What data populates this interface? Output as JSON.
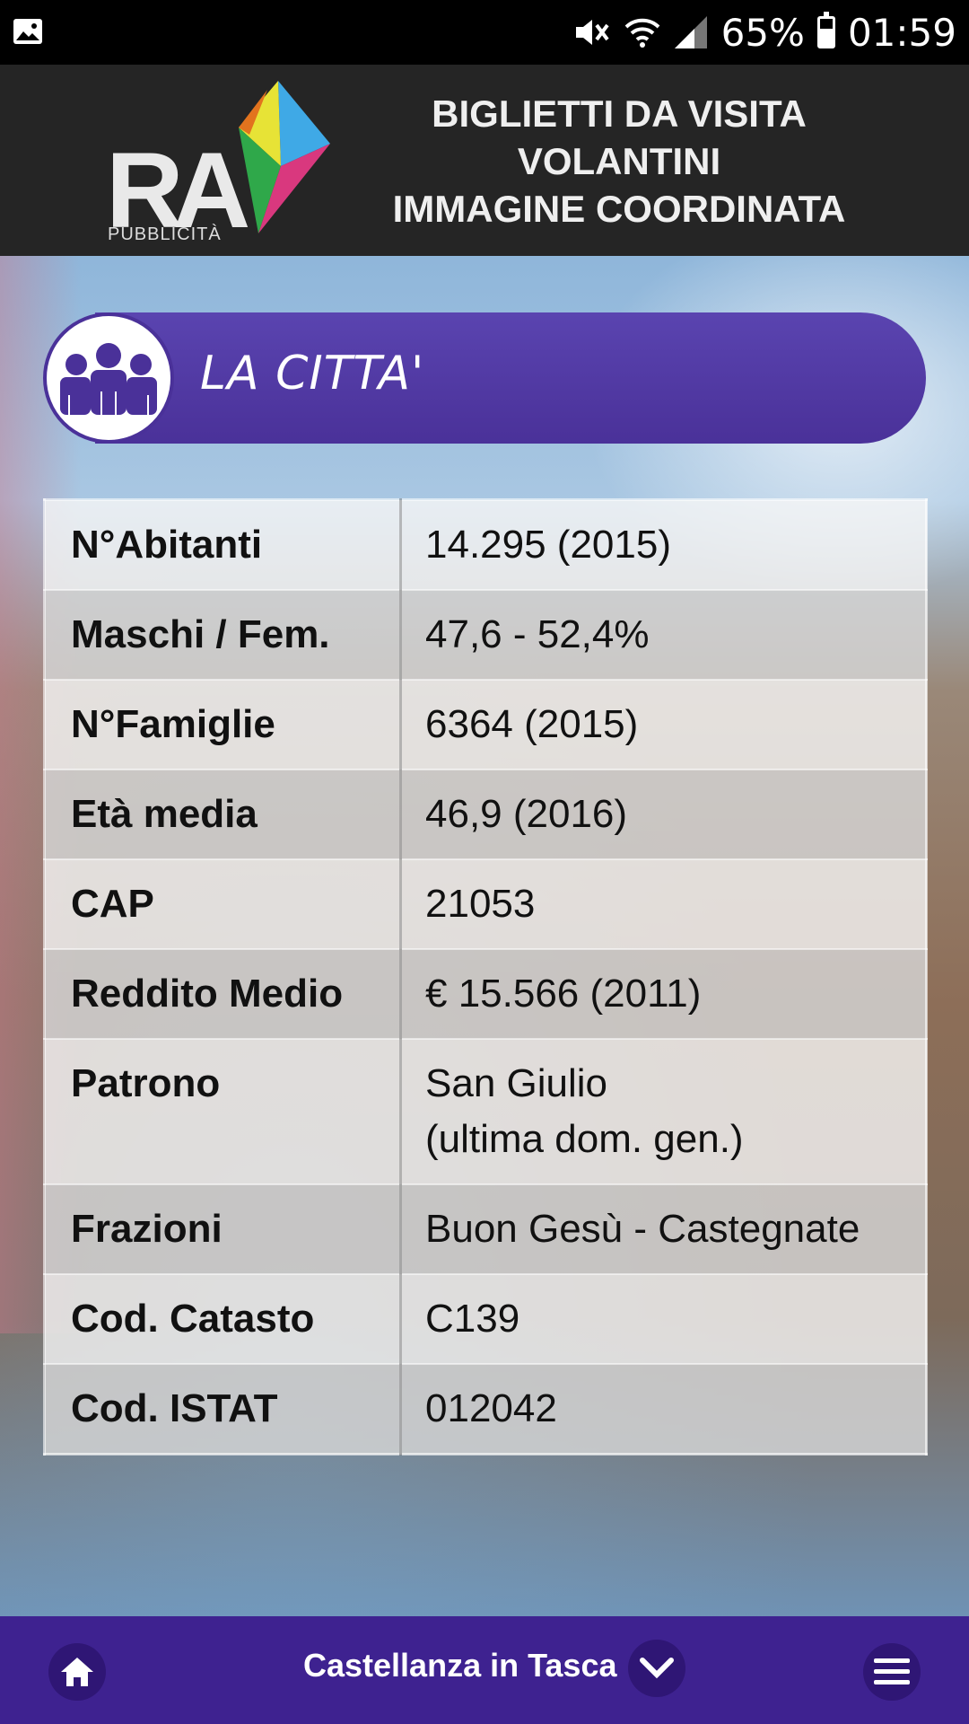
{
  "status_bar": {
    "battery_text": "65%",
    "time": "01:59",
    "icons": [
      "gallery-icon",
      "mute-icon",
      "wifi-icon",
      "signal-icon",
      "battery-icon"
    ]
  },
  "banner": {
    "logo_letters": "RA",
    "logo_subtitle": "PUBBLICITÀ",
    "lines": [
      "BIGLIETTI DA VISITA",
      "VOLANTINI",
      "IMMAGINE COORDINATA"
    ]
  },
  "section": {
    "title": "LA CITTA'",
    "icon": "people-icon",
    "accent": "#4a3199"
  },
  "table": {
    "rows": [
      {
        "label": "N°Abitanti",
        "value": "14.295 (2015)",
        "value2": ""
      },
      {
        "label": "Maschi / Fem.",
        "value": "47,6 - 52,4%",
        "value2": ""
      },
      {
        "label": "N°Famiglie",
        "value": "6364 (2015)",
        "value2": ""
      },
      {
        "label": "Età media",
        "value": "46,9 (2016)",
        "value2": ""
      },
      {
        "label": "CAP",
        "value": "21053",
        "value2": ""
      },
      {
        "label": "Reddito Medio",
        "value": "€ 15.566 (2011)",
        "value2": ""
      },
      {
        "label": "Patrono",
        "value": "San Giulio",
        "value2": "(ultima dom. gen.)"
      },
      {
        "label": "Frazioni",
        "value": "Buon Gesù - Castegnate",
        "value2": ""
      },
      {
        "label": "Cod. Catasto",
        "value": "C139",
        "value2": ""
      },
      {
        "label": "Cod. ISTAT",
        "value": "012042",
        "value2": ""
      }
    ]
  },
  "bottom_bar": {
    "title": "Castellanza in Tasca",
    "home_icon": "home-icon",
    "chevron_icon": "chevron-down-icon",
    "menu_icon": "hamburger-menu-icon",
    "color": "#3e2290"
  }
}
